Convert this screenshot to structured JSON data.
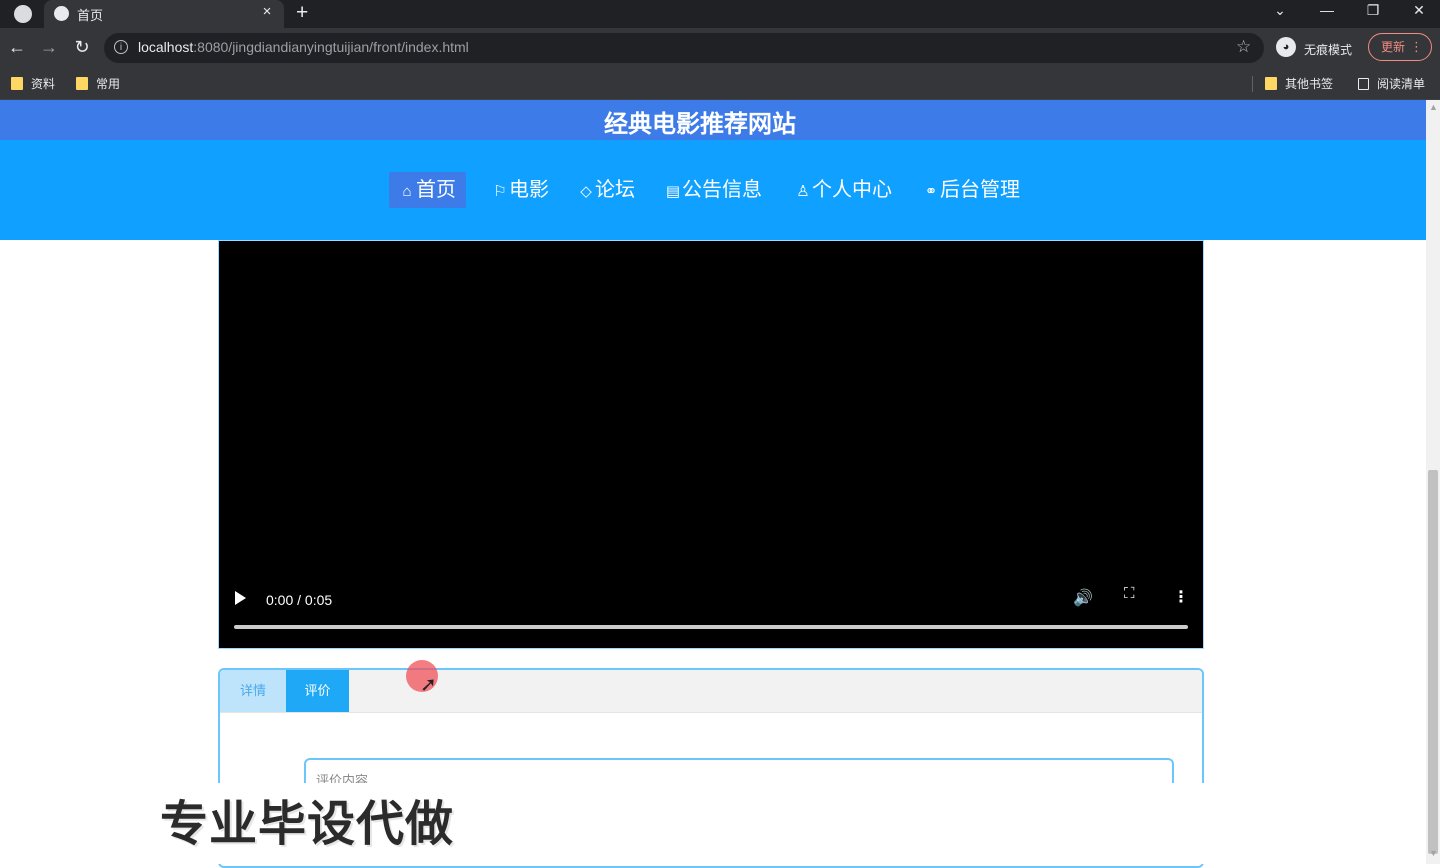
{
  "browser": {
    "tab_title": "首页",
    "tab_close": "×",
    "new_tab": "+",
    "url_host": "localhost",
    "url_path": ":8080/jingdiandianyingtuijian/front/index.html",
    "incognito_label": "无痕模式",
    "update_label": "更新",
    "bookmarks": [
      "资料",
      "常用"
    ],
    "other_bookmarks": "其他书签",
    "reading_list": "阅读清单"
  },
  "site": {
    "title": "经典电影推荐网站",
    "nav": [
      {
        "label": "首页",
        "icon": "⌂"
      },
      {
        "label": "电影",
        "icon": "⚐"
      },
      {
        "label": "论坛",
        "icon": "◇"
      },
      {
        "label": "公告信息",
        "icon": "▤"
      },
      {
        "label": "个人中心",
        "icon": "♙"
      },
      {
        "label": "后台管理",
        "icon": "⚭"
      }
    ]
  },
  "video": {
    "time": "0:00 / 0:05",
    "progress": 0
  },
  "panel": {
    "tabs": [
      "详情",
      "评价"
    ],
    "active_tab": "评价",
    "review_placeholder": "评价内容"
  },
  "watermark": "专业毕设代做"
}
